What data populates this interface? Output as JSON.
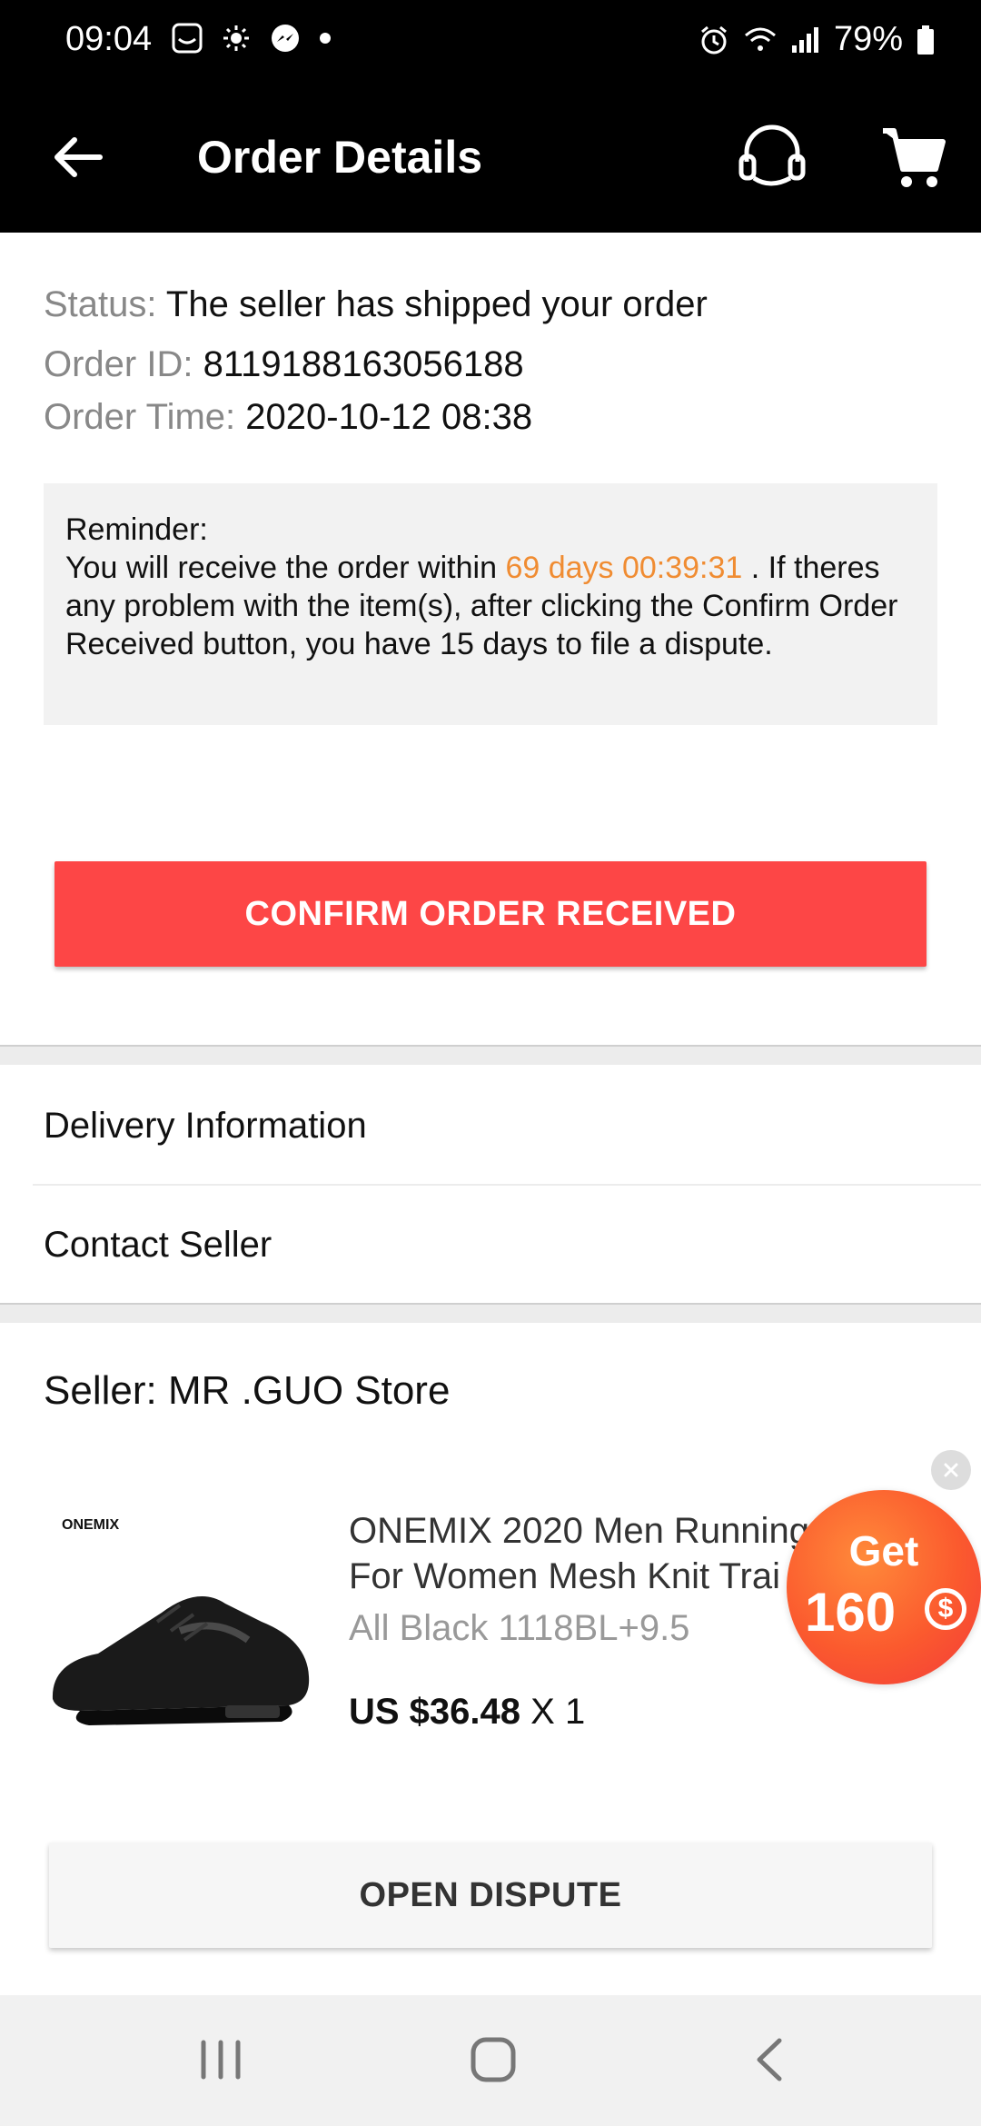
{
  "status_bar": {
    "time": "09:04",
    "battery": "79%",
    "left_icons": [
      "gallery-icon",
      "weather-icon",
      "messenger-icon",
      "dot-icon"
    ],
    "right_icons": [
      "alarm-icon",
      "wifi-icon",
      "signal-icon",
      "battery-icon"
    ]
  },
  "app_bar": {
    "title": "Order Details",
    "icons": [
      "back-arrow-icon",
      "headset-icon",
      "cart-icon"
    ]
  },
  "order": {
    "status_label": "Status:",
    "status_value": "The seller has shipped your order",
    "id_label": "Order ID:",
    "id_value": "8119188163056188",
    "time_label": "Order Time:",
    "time_value": "2020-10-12 08:38"
  },
  "reminder": {
    "heading": "Reminder:",
    "text_before": "You will receive the order within ",
    "countdown": "69 days 00:39:31",
    "text_after": " . If theres any problem with the item(s), after clicking the Confirm Order Received button, you have 15 days to file a dispute."
  },
  "confirm_button": "CONFIRM ORDER RECEIVED",
  "menu": {
    "delivery": "Delivery Information",
    "contact": "Contact Seller"
  },
  "seller": {
    "label": "Seller: MR .GUO Store"
  },
  "product": {
    "title_line1": "ONEMIX 2020 Men Running",
    "title_line2": "For Women Mesh Knit Trai",
    "variant": "All Black 1118BL+9.5",
    "price": "US $36.48",
    "quantity": "X 1",
    "brand_logo_text": "ONEMIX"
  },
  "promo": {
    "get": "Get",
    "amount": "160",
    "currency": "$"
  },
  "dispute_button": "OPEN DISPUTE",
  "nav": {
    "icons": [
      "recent-apps-icon",
      "home-icon",
      "back-icon"
    ]
  },
  "colors": {
    "primary_red": "#fd4646",
    "countdown_orange": "#f08c32",
    "app_bar_bg": "#000000"
  }
}
